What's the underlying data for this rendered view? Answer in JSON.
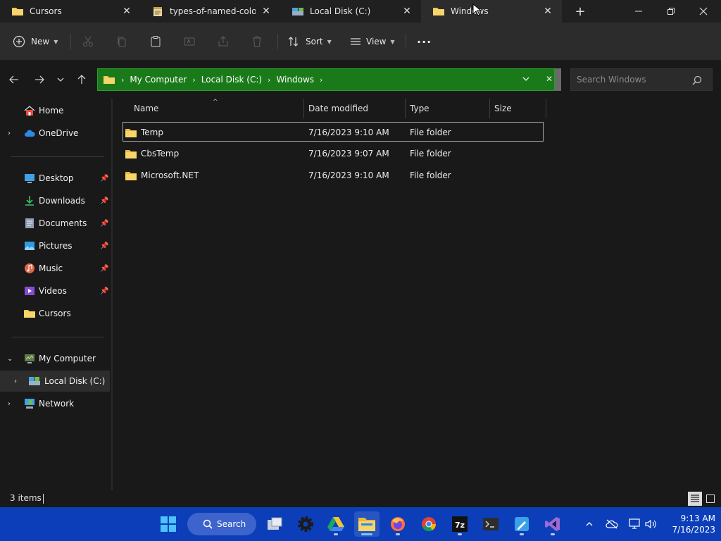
{
  "tabs": [
    {
      "label": "Cursors",
      "icon": "folder-icon",
      "close": "✕"
    },
    {
      "label": "types-of-named-colors",
      "icon": "notepad-icon",
      "close": "✕"
    },
    {
      "label": "Local Disk (C:)",
      "icon": "drive-icon",
      "close": "✕"
    },
    {
      "label": "Windows",
      "icon": "folder-icon",
      "close": "✕"
    }
  ],
  "new_tab": "+",
  "commands": {
    "new": "New",
    "sort": "Sort",
    "view": "View",
    "more": "···"
  },
  "breadcrumb": [
    "My Computer",
    "Local Disk (C:)",
    "Windows"
  ],
  "address_close": "✕",
  "search": {
    "placeholder": "Search Windows"
  },
  "sidebar": {
    "home": "Home",
    "onedrive": "OneDrive",
    "quick": [
      "Desktop",
      "Downloads",
      "Documents",
      "Pictures",
      "Music",
      "Videos",
      "Cursors"
    ],
    "my_computer": "My Computer",
    "local_disk": "Local Disk (C:)",
    "network": "Network"
  },
  "columns": {
    "name": "Name",
    "date": "Date modified",
    "type": "Type",
    "size": "Size"
  },
  "files": [
    {
      "name": "Temp",
      "date": "7/16/2023 9:10 AM",
      "type": "File folder",
      "size": ""
    },
    {
      "name": "CbsTemp",
      "date": "7/16/2023 9:07 AM",
      "type": "File folder",
      "size": ""
    },
    {
      "name": "Microsoft.NET",
      "date": "7/16/2023 9:10 AM",
      "type": "File folder",
      "size": ""
    }
  ],
  "status": {
    "items": "3 items"
  },
  "taskbar": {
    "search_label": "Search"
  },
  "clock": {
    "time": "9:13 AM",
    "date": "7/16/2023"
  },
  "colors": {
    "address_bg": "#1a7a1a",
    "taskbar_bg": "#0b3eb8",
    "folder": "#f0c64a"
  }
}
